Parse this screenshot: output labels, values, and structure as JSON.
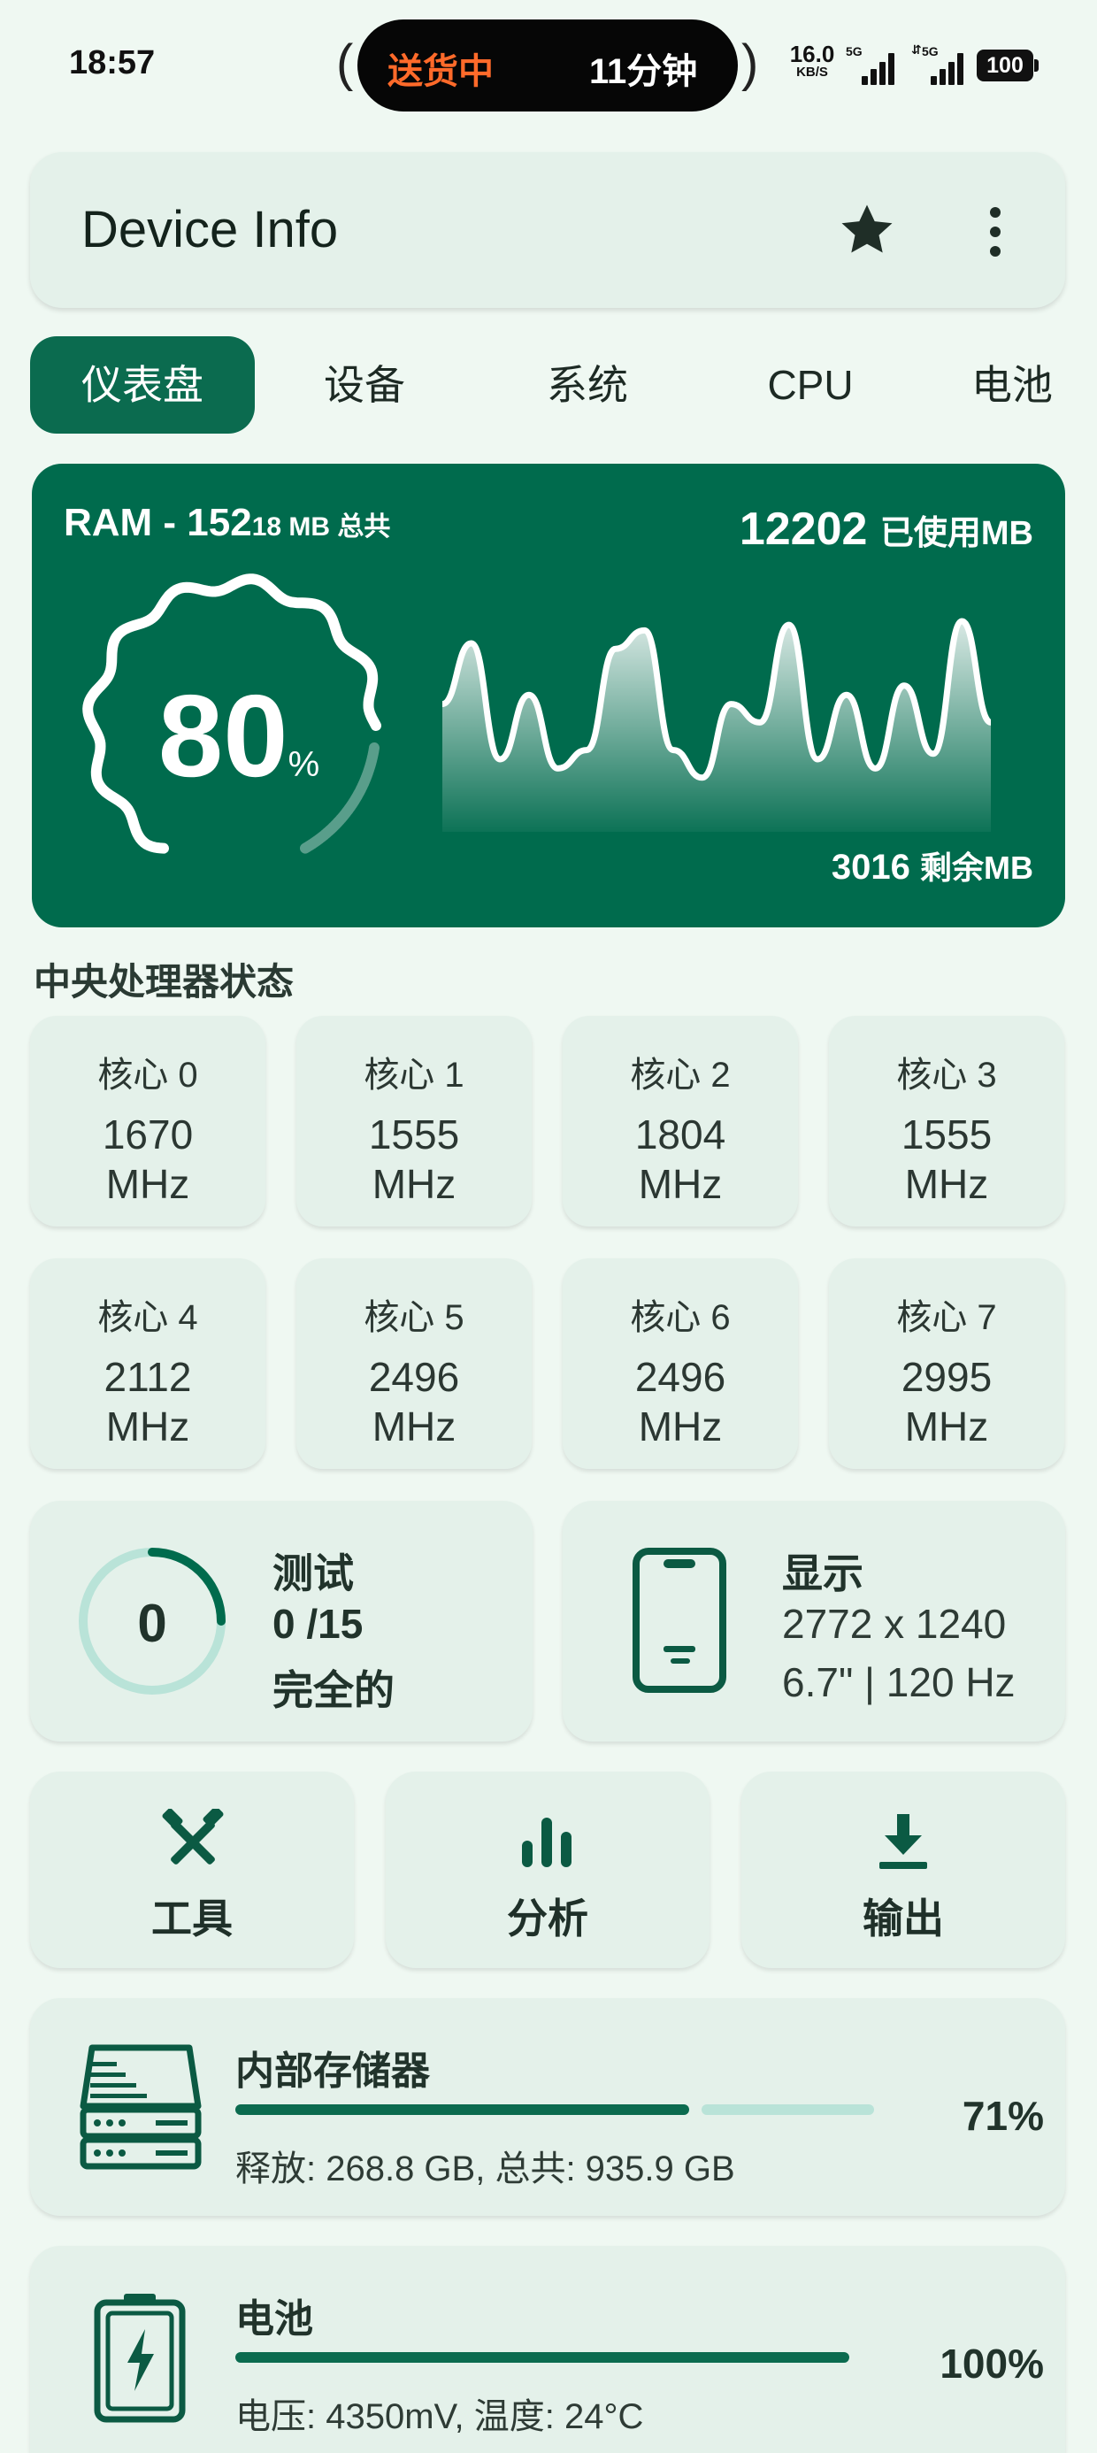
{
  "status_bar": {
    "time": "18:57",
    "island_left": "送货中",
    "island_right": "11分钟",
    "net_speed": "16.0",
    "net_speed_unit": "KB/S",
    "sim1_label": "5G",
    "sim2_label": "5G",
    "battery": "100"
  },
  "app_bar": {
    "title": "Device Info",
    "icons": [
      "star-icon",
      "more-vert-icon"
    ]
  },
  "tabs": [
    {
      "label": "仪表盘",
      "active": true
    },
    {
      "label": "设备",
      "active": false
    },
    {
      "label": "系统",
      "active": false
    },
    {
      "label": "CPU",
      "active": false
    },
    {
      "label": "电池",
      "active": false
    }
  ],
  "ram": {
    "title": "RAM - 152",
    "title_small": "18 MB 总共",
    "used_value": "12202",
    "used_label": "已使用MB",
    "free_value": "3016",
    "free_label": "剩余MB",
    "percent": "80",
    "percent_unit": "%",
    "usage_fraction": 0.8,
    "wave_values": [
      0.55,
      0.88,
      0.25,
      0.6,
      0.2,
      0.3,
      0.85,
      0.95,
      0.3,
      0.15,
      0.55,
      0.45,
      0.98,
      0.25,
      0.6,
      0.2,
      0.65,
      0.28,
      1.0,
      0.45
    ],
    "colors": {
      "card": "#006b4d",
      "line": "#ffffff"
    }
  },
  "cpu_section": {
    "title": "中央处理器状态",
    "cores": [
      {
        "label": "核心 0",
        "value": "1670",
        "unit": "MHz"
      },
      {
        "label": "核心 1",
        "value": "1555",
        "unit": "MHz"
      },
      {
        "label": "核心 2",
        "value": "1804",
        "unit": "MHz"
      },
      {
        "label": "核心 3",
        "value": "1555",
        "unit": "MHz"
      },
      {
        "label": "核心 4",
        "value": "2112",
        "unit": "MHz"
      },
      {
        "label": "核心 5",
        "value": "2496",
        "unit": "MHz"
      },
      {
        "label": "核心 6",
        "value": "2496",
        "unit": "MHz"
      },
      {
        "label": "核心 7",
        "value": "2995",
        "unit": "MHz"
      }
    ]
  },
  "tests": {
    "count": "0",
    "title": "测试",
    "progress": "0 /15",
    "status": "完全的",
    "progress_fraction": 0.0
  },
  "display": {
    "title": "显示",
    "resolution": "2772 x 1240",
    "spec": "6.7\" | 120 Hz",
    "icon": "phone-icon"
  },
  "actions": [
    {
      "label": "工具",
      "icon": "tools-icon"
    },
    {
      "label": "分析",
      "icon": "bar-chart-icon"
    },
    {
      "label": "输出",
      "icon": "download-icon"
    }
  ],
  "storage": {
    "title": "内部存储器",
    "detail": "释放: 268.8 GB,  总共: 935.9 GB",
    "percent_label": "71%",
    "fraction": 0.71,
    "icon": "storage-icon"
  },
  "battery_card": {
    "title": "电池",
    "detail": "电压: 4350mV,  温度: 24°C",
    "percent_label": "100%",
    "fraction": 1.0,
    "icon": "battery-charging-icon"
  },
  "colors": {
    "accent": "#006b4d",
    "card_bg": "#e4f1ea",
    "page_bg": "#eff8f2",
    "track": "#b9e3d8",
    "island_accent": "#ff6a2a"
  }
}
